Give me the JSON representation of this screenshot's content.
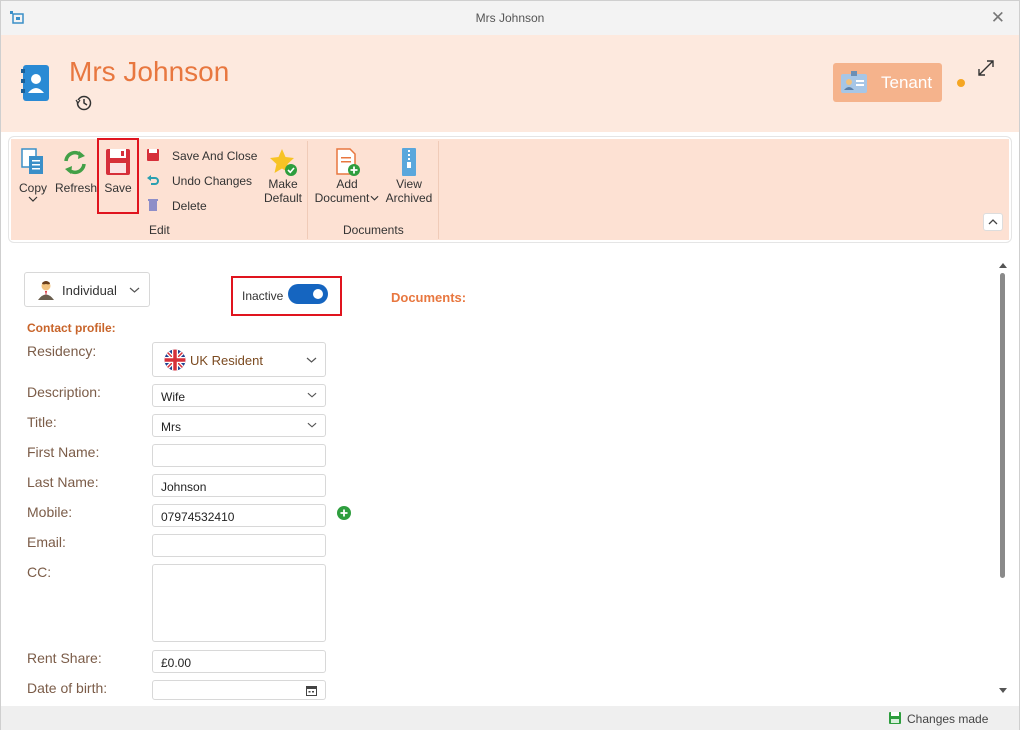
{
  "window": {
    "title": "Mrs Johnson"
  },
  "header": {
    "title": "Mrs Johnson",
    "badge_label": "Tenant"
  },
  "ribbon": {
    "copy_label": "Copy",
    "refresh_label": "Refresh",
    "save_label": "Save",
    "save_close_label": "Save And Close",
    "undo_label": "Undo Changes",
    "delete_label": "Delete",
    "make_default_line1": "Make",
    "make_default_line2": "Default",
    "add_document_line1": "Add",
    "add_document_line2": "Document",
    "view_archived_line1": "View",
    "view_archived_line2": "Archived",
    "group_edit": "Edit",
    "group_documents": "Documents"
  },
  "form": {
    "contact_type": "Individual",
    "active_toggle_label": "Inactive",
    "documents_title": "Documents:",
    "section_title": "Contact profile:",
    "residency_label": "Residency:",
    "residency_value": "UK Resident",
    "description_label": "Description:",
    "description_value": "Wife",
    "title_label": "Title:",
    "title_value": "Mrs",
    "first_name_label": "First Name:",
    "first_name_value": "",
    "last_name_label": "Last Name:",
    "last_name_value": "Johnson",
    "mobile_label": "Mobile:",
    "mobile_value": "07974532410",
    "email_label": "Email:",
    "email_value": "",
    "cc_label": "CC:",
    "cc_value": "",
    "rent_share_label": "Rent Share:",
    "rent_share_value": "£0.00",
    "dob_label": "Date of birth:",
    "dob_value": ""
  },
  "status": {
    "text": "Changes made"
  },
  "colors": {
    "accent": "#e8773f",
    "header_bg": "#fde9de",
    "ribbon_bg": "#fde1d3",
    "toggle_on": "#1565c0",
    "highlight": "#e0141e"
  }
}
